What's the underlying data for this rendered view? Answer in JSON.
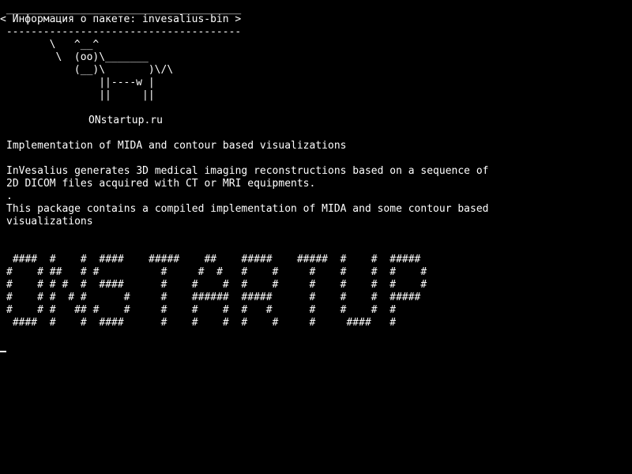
{
  "terminal": {
    "background": "#000000",
    "foreground": "#ffffff",
    "cowsay": {
      "top_border": " ______________________________________",
      "title_line": "< Информация о пакете: invesalius-bin >",
      "bottom_border": " --------------------------------------",
      "cow": [
        "        \\   ^__^",
        "         \\  (oo)\\_______",
        "            (__)\\       )\\/\\",
        "                ||----w |",
        "                ||     ||"
      ],
      "site": "ONstartup.ru"
    },
    "summary": "Implementation of MIDA and contour based visualizations",
    "description": [
      "InVesalius generates 3D medical imaging reconstructions based on a sequence of",
      "2D DICOM files acquired with CT or MRI equipments.",
      ".",
      "This package contains a compiled implementation of MIDA and some contour based",
      "visualizations"
    ],
    "banner": [
      " ####  #    #  ####    #####    ##    #####    #####  #    #  #####",
      "#    # ##   # #          #     #  #   #    #     #    #    #  #    #",
      "#    # # #  #  ####      #    #    #  #    #     #    #    #  #    #",
      "#    # #  # #      #     #    ######  #####      #    #    #  #####",
      "#    # #   ## #    #     #    #    #  #   #      #    #    #  #",
      " ####  #    #  ####      #    #    #  #    #     #     ####   #"
    ],
    "cursor_icon": "block-cursor"
  }
}
